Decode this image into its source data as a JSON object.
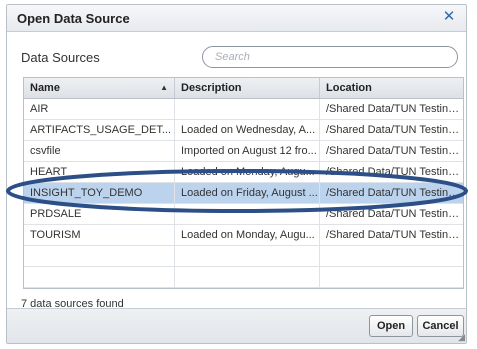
{
  "dialog": {
    "title": "Open Data Source",
    "close_glyph": "✕",
    "section_label": "Data Sources",
    "search_placeholder": "Search"
  },
  "table": {
    "columns": [
      "Name",
      "Description",
      "Location"
    ],
    "sort_indicator": "▲",
    "rows": [
      {
        "name": "AIR",
        "description": "",
        "location": "/Shared Data/TUN Testing..."
      },
      {
        "name": "ARTIFACTS_USAGE_DET...",
        "description": "Loaded on Wednesday, A...",
        "location": "/Shared Data/TUN Testing..."
      },
      {
        "name": "csvfile",
        "description": "Imported on August 12 fro...",
        "location": "/Shared Data/TUN Testing..."
      },
      {
        "name": "HEART",
        "description": "Loaded on Monday, Augu...",
        "location": "/Shared Data/TUN Testing..."
      },
      {
        "name": "INSIGHT_TOY_DEMO",
        "description": "Loaded on Friday, August ...",
        "location": "/Shared Data/TUN Testing..."
      },
      {
        "name": "PRDSALE",
        "description": "",
        "location": "/Shared Data/TUN Testing..."
      },
      {
        "name": "TOURISM",
        "description": "Loaded on Monday, Augu...",
        "location": "/Shared Data/TUN Testing..."
      }
    ],
    "selected_index": 4
  },
  "status_text": "7 data sources found",
  "buttons": {
    "open": "Open",
    "cancel": "Cancel"
  },
  "colors": {
    "selection": "#bcd3ee",
    "annotation_ellipse": "#2b4f86",
    "accent": "#2f6db0"
  }
}
